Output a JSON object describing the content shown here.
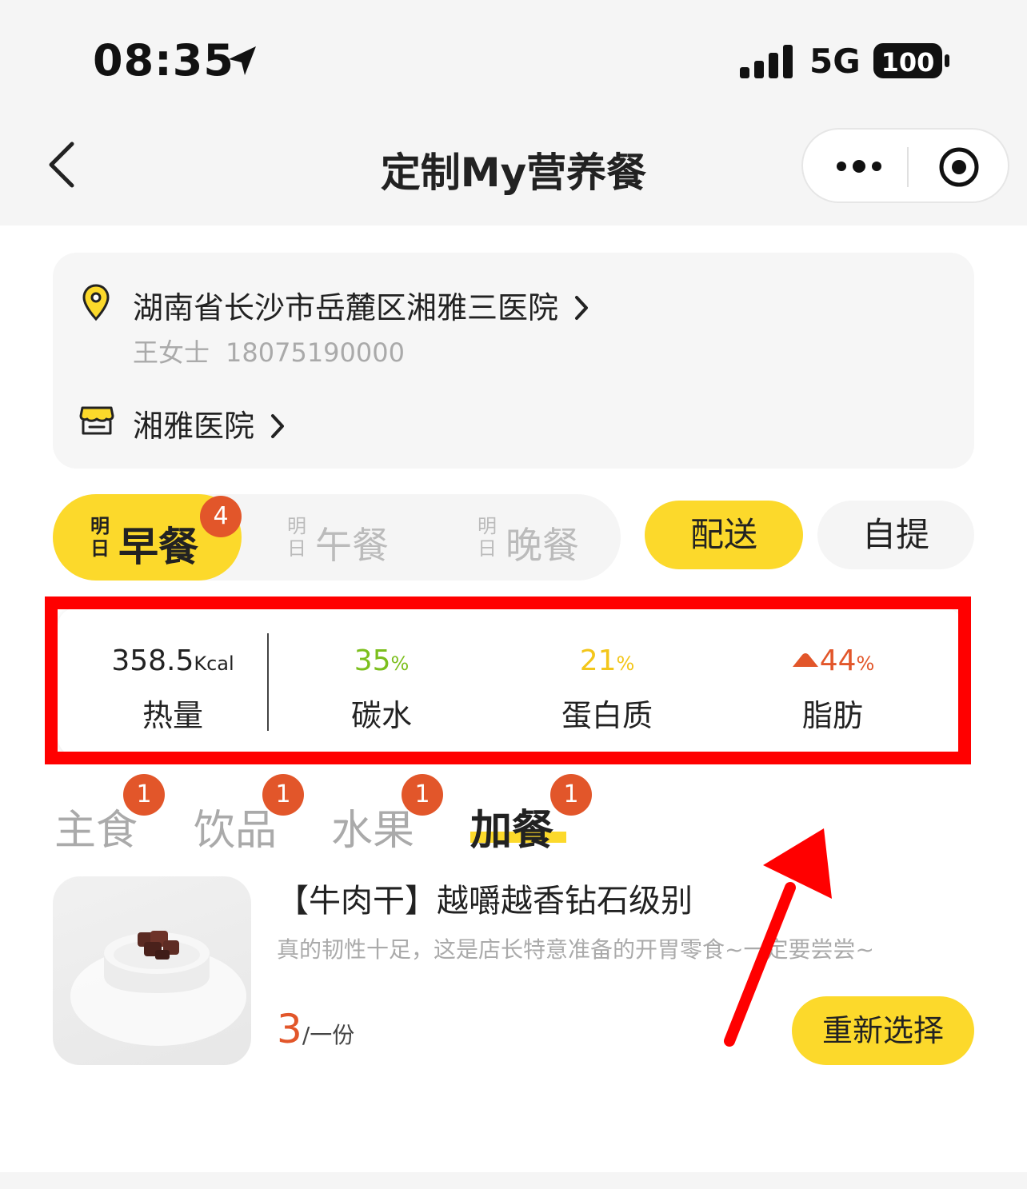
{
  "status_bar": {
    "time": "08:35",
    "network": "5G",
    "battery": "100"
  },
  "nav": {
    "title": "定制My营养餐"
  },
  "address": {
    "text": "湖南省长沙市岳麓区湘雅三医院",
    "contact_name": "王女士",
    "phone": "18075190000",
    "store": "湘雅医院"
  },
  "meal_tabs": [
    {
      "prefix": "明日",
      "label": "早餐",
      "badge": "4",
      "active": true
    },
    {
      "prefix": "明日",
      "label": "午餐",
      "active": false
    },
    {
      "prefix": "明日",
      "label": "晚餐",
      "active": false
    }
  ],
  "delivery": {
    "options": [
      "配送",
      "自提"
    ],
    "selected": "配送"
  },
  "nutrition": {
    "calories": {
      "value": "358.5",
      "unit": "Kcal",
      "label": "热量"
    },
    "carbs": {
      "value": "35",
      "unit": "%",
      "label": "碳水",
      "color": "#7cbf1d"
    },
    "protein": {
      "value": "21",
      "unit": "%",
      "label": "蛋白质",
      "color": "#f3c61a"
    },
    "fat": {
      "value": "44",
      "unit": "%",
      "label": "脂肪",
      "color": "#e2562a",
      "indicator": "up-triangle-icon"
    }
  },
  "categories": [
    {
      "label": "主食",
      "badge": "1",
      "active": false
    },
    {
      "label": "饮品",
      "badge": "1",
      "active": false
    },
    {
      "label": "水果",
      "badge": "1",
      "active": false
    },
    {
      "label": "加餐",
      "badge": "1",
      "active": true
    }
  ],
  "product": {
    "name": "【牛肉干】越嚼越香钻石级别",
    "description": "真的韧性十足，这是店长特意准备的开胃零食~一定要尝尝~",
    "price": "3",
    "unit": "/一份",
    "button": "重新选择"
  },
  "colors": {
    "accent": "#fcd92b",
    "badge": "#e2562a",
    "annotation": "#ff0000"
  }
}
